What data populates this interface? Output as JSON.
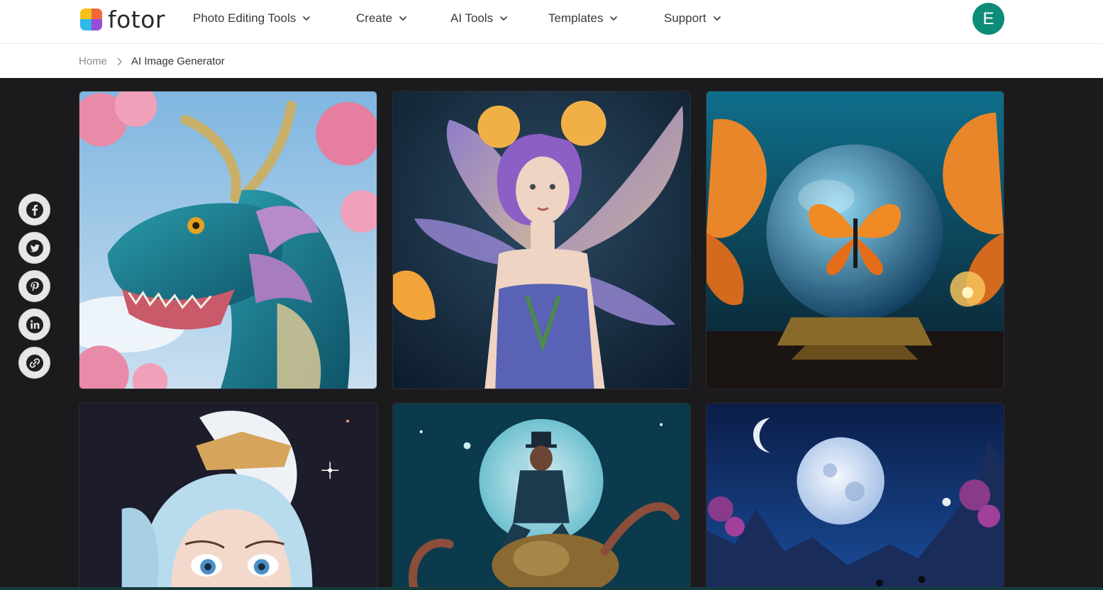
{
  "header": {
    "logo_text": "fotor",
    "nav": [
      {
        "label": "Photo Editing Tools"
      },
      {
        "label": "Create"
      },
      {
        "label": "AI Tools"
      },
      {
        "label": "Templates"
      },
      {
        "label": "Support"
      }
    ],
    "avatar_initial": "E",
    "avatar_color": "#0d8c78"
  },
  "breadcrumb": {
    "home": "Home",
    "current": "AI Image Generator"
  },
  "social": [
    {
      "icon": "facebook-icon"
    },
    {
      "icon": "twitter-icon"
    },
    {
      "icon": "pinterest-icon"
    },
    {
      "icon": "linkedin-icon"
    },
    {
      "icon": "link-icon"
    }
  ],
  "gallery": [
    {
      "subject": "dragon-image"
    },
    {
      "subject": "fairy-image"
    },
    {
      "subject": "butterfly-globe-image"
    },
    {
      "subject": "anime-girl-image"
    },
    {
      "subject": "octopus-rider-image"
    },
    {
      "subject": "moon-landscape-image"
    }
  ],
  "colors": {
    "background": "#1b1b1d",
    "header_bg": "#ffffff",
    "accent": "#0d8c78"
  }
}
